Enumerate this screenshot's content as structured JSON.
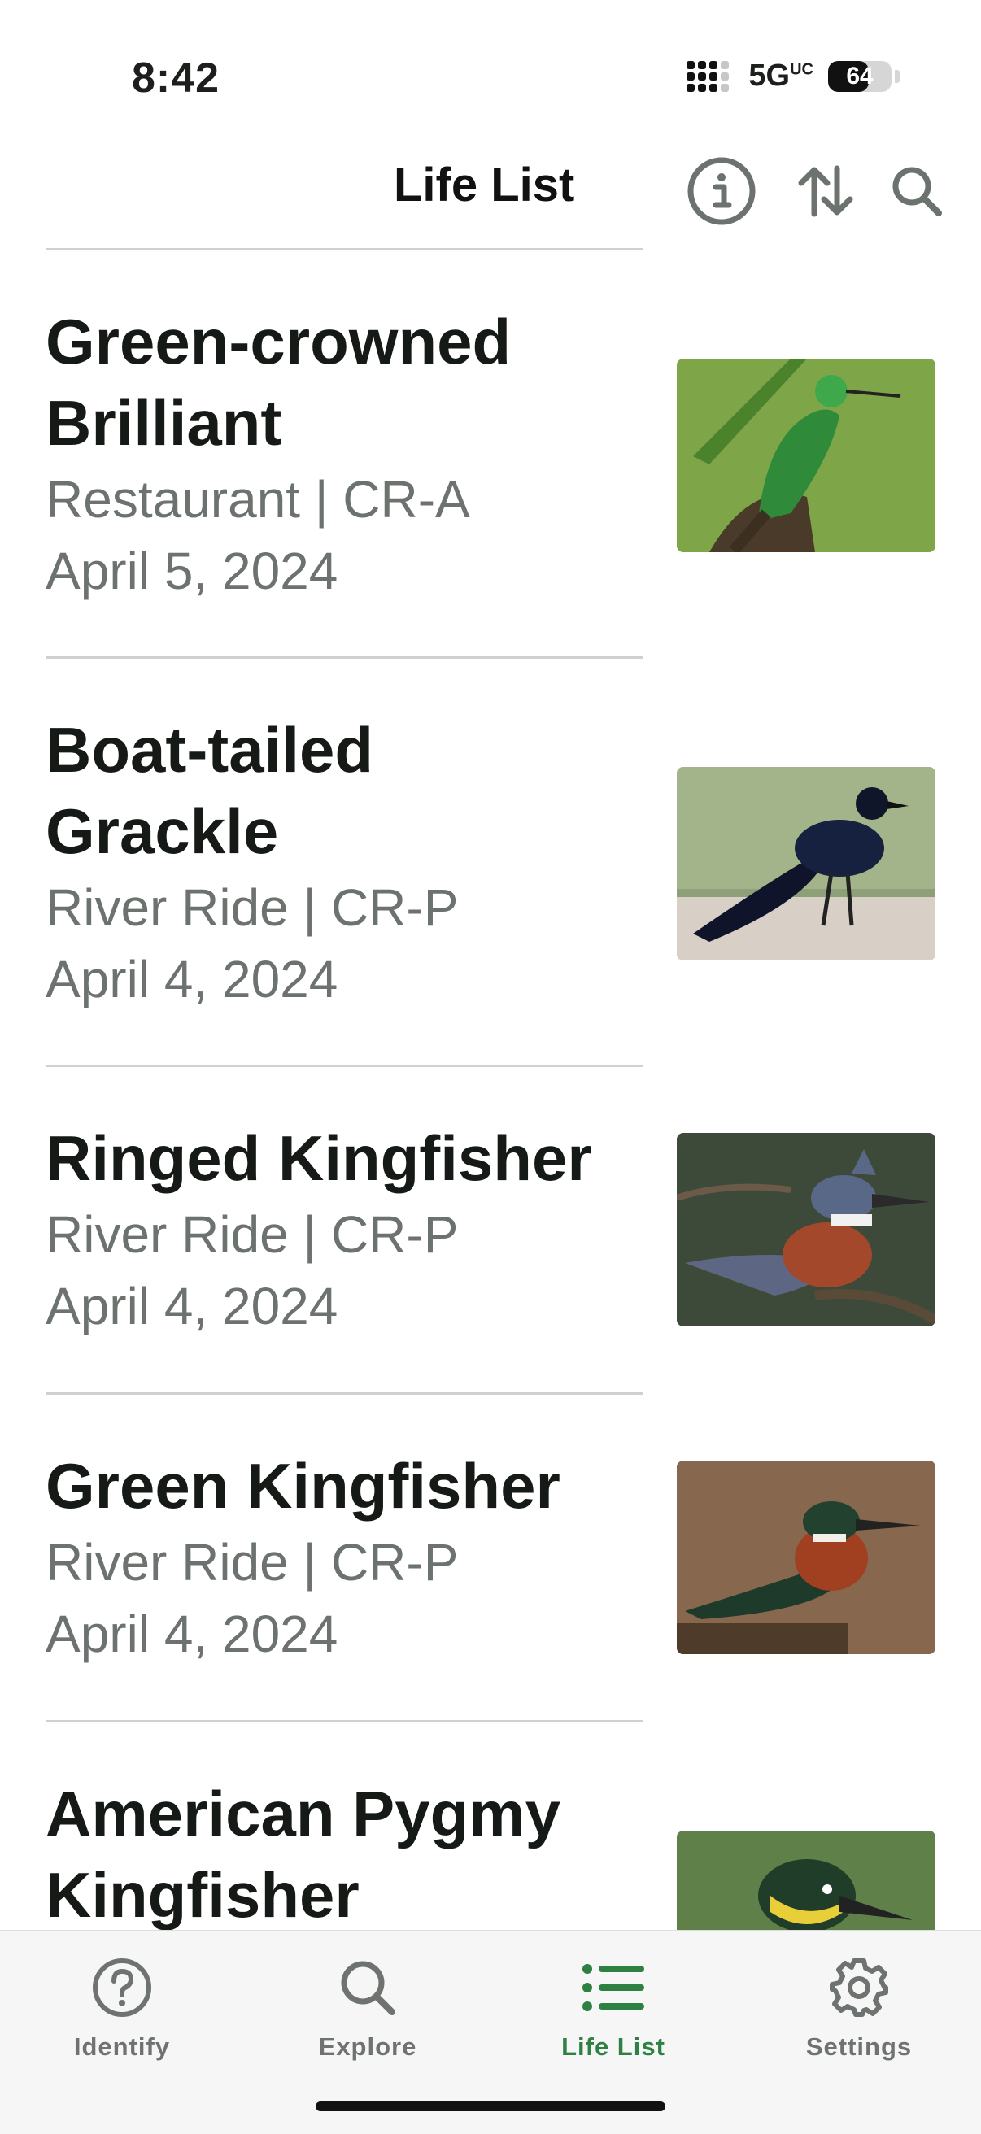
{
  "status": {
    "time": "8:42",
    "network": "5G",
    "network_sup": "UC",
    "battery_percent": 64,
    "battery_label": "64"
  },
  "header": {
    "title": "Life List",
    "icons": [
      "info-icon",
      "sort-icon",
      "search-icon"
    ]
  },
  "entries": [
    {
      "species_line1": "Green-crowned",
      "species_line2": "Brilliant",
      "place": "Restaurant | CR-A",
      "date": "April 5, 2024"
    },
    {
      "species_line1": "Boat-tailed",
      "species_line2": "Grackle",
      "place": "River Ride | CR-P",
      "date": "April 4, 2024"
    },
    {
      "species_line1": "Ringed Kingfisher",
      "place": "River Ride | CR-P",
      "date": "April 4, 2024"
    },
    {
      "species_line1": "Green Kingfisher",
      "place": "River Ride | CR-P",
      "date": "April 4, 2024"
    },
    {
      "species_line1": "American Pygmy",
      "species_line2": "Kingfisher"
    }
  ],
  "tabs": [
    {
      "label": "Identify",
      "icon": "question-circle-icon",
      "active": false
    },
    {
      "label": "Explore",
      "icon": "search-icon",
      "active": false
    },
    {
      "label": "Life List",
      "icon": "list-icon",
      "active": true
    },
    {
      "label": "Settings",
      "icon": "gear-icon",
      "active": false
    }
  ],
  "colors": {
    "accent": "#2f8043",
    "text_primary": "#161a16",
    "text_secondary": "#6c726d",
    "tabbar_bg": "#f5f6f5"
  }
}
